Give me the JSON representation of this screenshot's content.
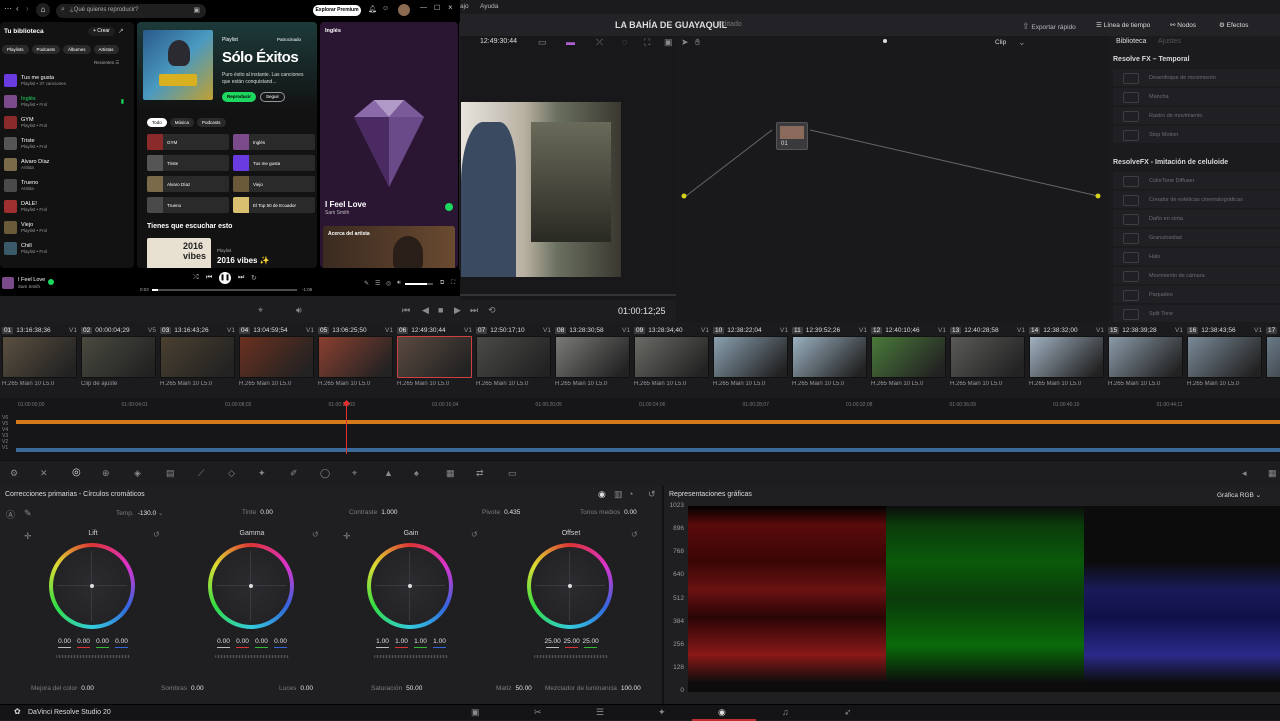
{
  "spotify": {
    "search_placeholder": "¿Qué quieres reproducir?",
    "explore_premium": "Explorar Premium",
    "library_title": "Tu biblioteca",
    "create_label": "+ Crear",
    "filters": [
      "Playlists",
      "Podcasts",
      "Álbumes",
      "Artistas"
    ],
    "recents_label": "Recientes",
    "library_items": [
      {
        "title": "Tus me gusta",
        "sub": "Playlist • 37 canciones",
        "color": "#6a3be0"
      },
      {
        "title": "Inglés",
        "sub": "Playlist • Frol",
        "color": "#7a4a8a",
        "active": true
      },
      {
        "title": "GYM",
        "sub": "Playlist • Frol",
        "color": "#8a2a2a"
      },
      {
        "title": "Triste",
        "sub": "Playlist • Frol",
        "color": "#555"
      },
      {
        "title": "Alvaro Díaz",
        "sub": "Artista",
        "color": "#7a6a4a"
      },
      {
        "title": "Trueno",
        "sub": "Artista",
        "color": "#4a4a4a"
      },
      {
        "title": "DALE!",
        "sub": "Playlist • Frol",
        "color": "#a03030"
      },
      {
        "title": "Viejo",
        "sub": "Playlist • Frol",
        "color": "#6a5a3a"
      },
      {
        "title": "Chill",
        "sub": "Playlist • Frol",
        "color": "#3a5a6a"
      }
    ],
    "hero": {
      "type_label": "Playlist",
      "patrocinado": "Patrocinado",
      "title": "Sólo Éxitos",
      "description": "Puro éxito al instante. Las canciones que están conquistand...",
      "play_label": "Reproducir",
      "follow_label": "Seguir"
    },
    "chips": [
      "Todo",
      "Música",
      "Podcasts"
    ],
    "tiles": [
      {
        "label": "GYM",
        "color": "#8a2a2a"
      },
      {
        "label": "Inglés",
        "color": "#7a4a8a"
      },
      {
        "label": "Triste",
        "color": "#555"
      },
      {
        "label": "Tus me gusta",
        "color": "#6a3be0"
      },
      {
        "label": "Alvaro Díaz",
        "color": "#7a6a4a"
      },
      {
        "label": "Viejo",
        "color": "#6a5a3a"
      },
      {
        "label": "Trueno",
        "color": "#4a4a4a"
      },
      {
        "label": "El Top 50 de Ecuador",
        "color": "#d8c070"
      }
    ],
    "section_title": "Tienes que escuchar esto",
    "rec": {
      "type": "Playlist",
      "title": "2016 vibes ✨",
      "thumb_text_1": "2016",
      "thumb_text_2": "vibes"
    },
    "now_playing_panel": {
      "playlist": "Inglés",
      "song": "I Feel Love",
      "artist": "Sam Smith",
      "about_label": "Acerca del artista"
    },
    "player": {
      "song": "I Feel Love",
      "artist": "Sam Smith",
      "elapsed": "0:03",
      "total": "-1:06",
      "progress": 0.04,
      "volume": 0.8
    }
  },
  "resolve": {
    "menu_fragment": "ajo",
    "menu_help": "Ayuda",
    "project_title": "LA BAHÍA DE GUAYAQUIL",
    "edited_label": "Editado",
    "quick_export": "Exportar rápido",
    "timeline_label": "Línea de tiempo",
    "nodes_label": "Nodos",
    "effects_label": "Efectos",
    "viewer_timecode": "12:49:30:44",
    "clip_label": "Clip",
    "library_tab": "Biblioteca",
    "settings_tab": "Ajustes",
    "playhead_timecode": "01:00:12;25",
    "node": {
      "label": "01"
    },
    "fx_sections": [
      {
        "title": "Resolve FX – Temporal",
        "items": [
          "Desenfoque de movimiento",
          "Mancha",
          "Rastro de movimiento",
          "Stop Motion"
        ]
      },
      {
        "title": "ResolveFX - Imitación de celuloide",
        "items": [
          "ColorTone Diffuser",
          "Creador de estéticas cinematográficas",
          "Daño en cinta",
          "Granulosidad",
          "Halo",
          "Movimiento de cámara",
          "Parpadeo",
          "Split Tone"
        ]
      }
    ],
    "clips": [
      {
        "num": "01",
        "tc": "13:16:38;36",
        "track": "V1",
        "label": "H.265 Main 10 L5.0",
        "color": "#5a5040"
      },
      {
        "num": "02",
        "tc": "00:00:04;29",
        "track": "V5",
        "label": "Clip de ajuste",
        "color": "#4a4a40"
      },
      {
        "num": "03",
        "tc": "13:16:43;26",
        "track": "V1",
        "label": "H.265 Main 10 L5.0",
        "color": "#4a4030"
      },
      {
        "num": "04",
        "tc": "13:04:59;54",
        "track": "V1",
        "label": "H.265 Main 10 L5.0",
        "color": "#6a3020"
      },
      {
        "num": "05",
        "tc": "13:06:25;50",
        "track": "V1",
        "label": "H.265 Main 10 L5.0",
        "color": "#8a4030"
      },
      {
        "num": "06",
        "tc": "12:49:30;44",
        "track": "V1",
        "label": "H.265 Main 10 L5.0",
        "color": "#5a4a40",
        "active": true
      },
      {
        "num": "07",
        "tc": "12:50:17;10",
        "track": "V1",
        "label": "H.265 Main 10 L5.0",
        "color": "#4a4a48"
      },
      {
        "num": "08",
        "tc": "13:28:30;58",
        "track": "V1",
        "label": "H.265 Main 10 L5.0",
        "color": "#7a7a78"
      },
      {
        "num": "09",
        "tc": "13:28:34;40",
        "track": "V1",
        "label": "H.265 Main 10 L5.0",
        "color": "#6a6a66"
      },
      {
        "num": "10",
        "tc": "12:38:22;04",
        "track": "V1",
        "label": "H.265 Main 10 L5.0",
        "color": "#8aa0b0"
      },
      {
        "num": "11",
        "tc": "12:39:52;26",
        "track": "V1",
        "label": "H.265 Main 10 L5.0",
        "color": "#9ab0c0"
      },
      {
        "num": "12",
        "tc": "12:40:10;46",
        "track": "V1",
        "label": "H.265 Main 10 L5.0",
        "color": "#4a7a3a"
      },
      {
        "num": "13",
        "tc": "12:40:28;58",
        "track": "V1",
        "label": "H.265 Main 10 L5.0",
        "color": "#5a5a58"
      },
      {
        "num": "14",
        "tc": "12:38:32;00",
        "track": "V1",
        "label": "H.265 Main 10 L5.0",
        "color": "#a0b0c0"
      },
      {
        "num": "15",
        "tc": "12:38:39;28",
        "track": "V1",
        "label": "H.265 Main 10 L5.0",
        "color": "#8a9aa8"
      },
      {
        "num": "16",
        "tc": "12:38:43;56",
        "track": "V1",
        "label": "H.265 Main 10 L5.0",
        "color": "#7a8a98"
      },
      {
        "num": "17",
        "tc": "",
        "track": "",
        "label": "",
        "color": "#6a7a88"
      }
    ],
    "ruler": [
      "01:00:00;00",
      "01:00:04;01",
      "01:00:08;02",
      "01:00:12;03",
      "01:00:16;04",
      "01:00:20;05",
      "01:00:24;06",
      "01:00:28;07",
      "01:00:32;08",
      "01:00:36;09",
      "01:00:40;10",
      "01:00:44;11"
    ],
    "tracks": [
      "V6",
      "V5",
      "V4",
      "V3",
      "V2",
      "V1"
    ],
    "primaries": {
      "title": "Correcciones primarias - Círculos cromáticos",
      "temp_label": "Temp.",
      "temp_value": "-130.0",
      "tint_label": "Tinte",
      "tint_value": "0.00",
      "contrast_label": "Contraste",
      "contrast_value": "1.000",
      "pivot_label": "Pivote",
      "pivot_value": "0.435",
      "midtone_label": "Tonos medios",
      "midtone_value": "0.00",
      "wheels": [
        {
          "name": "Lift",
          "values": [
            "0.00",
            "0.00",
            "0.00",
            "0.00"
          ]
        },
        {
          "name": "Gamma",
          "values": [
            "0.00",
            "0.00",
            "0.00",
            "0.00"
          ]
        },
        {
          "name": "Gain",
          "values": [
            "1.00",
            "1.00",
            "1.00",
            "1.00"
          ]
        },
        {
          "name": "Offset",
          "values": [
            "25.00",
            "25.00",
            "25.00"
          ]
        }
      ],
      "color_boost_label": "Mejora del color",
      "color_boost_value": "0.00",
      "shadows_label": "Sombras",
      "shadows_value": "0.00",
      "highlights_label": "Luces",
      "highlights_value": "0.00",
      "saturation_label": "Saturación",
      "saturation_value": "50.00",
      "hue_label": "Matiz",
      "hue_value": "50.00",
      "lummix_label": "Mezclador de luminancia",
      "lummix_value": "100.00"
    },
    "scopes": {
      "title": "Representaciones gráficas",
      "mode": "Gráfica RGB",
      "scale": [
        "1023",
        "896",
        "768",
        "640",
        "512",
        "384",
        "256",
        "128",
        "0"
      ]
    },
    "app_name": "DaVinci Resolve Studio 20"
  }
}
